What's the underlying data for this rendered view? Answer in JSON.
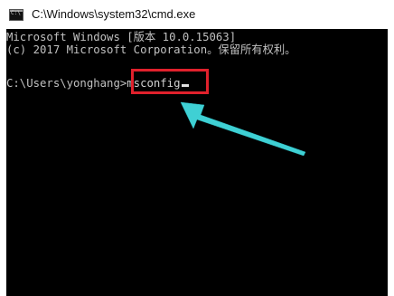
{
  "window": {
    "title": "C:\\Windows\\system32\\cmd.exe",
    "icon": "cmd-icon"
  },
  "console": {
    "line1": "Microsoft Windows [版本 10.0.15063]",
    "line2": "(c) 2017 Microsoft Corporation。保留所有权利。",
    "prompt": "C:\\Users\\yonghang>",
    "command": "msconfig"
  },
  "annotation": {
    "box_color": "#e0212c",
    "arrow_color": "#3fd0d4"
  }
}
